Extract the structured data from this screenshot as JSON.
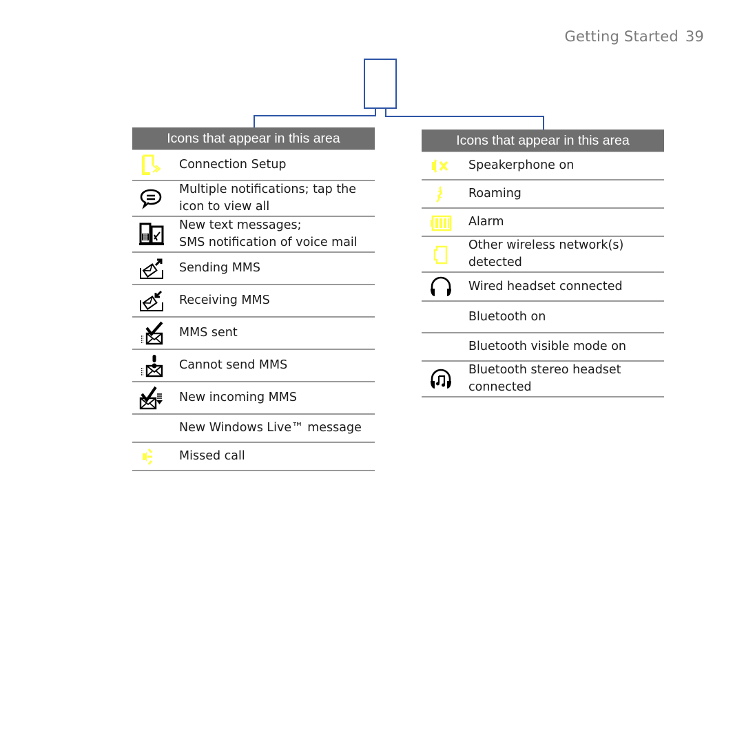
{
  "running_head": {
    "section": "Getting Started",
    "page": "39"
  },
  "diagram": {
    "colors": {
      "line": "#2e55a5",
      "icon_yellow": "#ffff44",
      "header_bg": "#6f6f6f"
    }
  },
  "left_table": {
    "header": "Icons that appear in this area",
    "rows": [
      {
        "icon": "connection-setup-icon",
        "label": "Connection Setup"
      },
      {
        "icon": "speech-bubble-icon",
        "label": "Multiple notifications; tap the icon to view all"
      },
      {
        "icon": "sms-voicemail-icon",
        "label": "New text messages;\nSMS notification of voice mail"
      },
      {
        "icon": "sending-mms-icon",
        "label": "Sending MMS"
      },
      {
        "icon": "receiving-mms-icon",
        "label": "Receiving MMS"
      },
      {
        "icon": "mms-sent-icon",
        "label": "MMS sent"
      },
      {
        "icon": "cannot-send-mms-icon",
        "label": "Cannot send MMS"
      },
      {
        "icon": "new-incoming-mms-icon",
        "label": "New incoming MMS"
      },
      {
        "icon": "",
        "label": "New Windows Live™ message"
      },
      {
        "icon": "missed-call-icon",
        "label": "Missed call"
      }
    ]
  },
  "right_table": {
    "header": "Icons that appear in this area",
    "rows": [
      {
        "icon": "speakerphone-icon",
        "label": "Speakerphone on"
      },
      {
        "icon": "roaming-icon",
        "label": "Roaming"
      },
      {
        "icon": "alarm-icon",
        "label": "Alarm"
      },
      {
        "icon": "wireless-network-icon",
        "label": "Other wireless network(s) detected"
      },
      {
        "icon": "wired-headset-icon",
        "label": "Wired headset connected"
      },
      {
        "icon": "",
        "label": "Bluetooth on"
      },
      {
        "icon": "",
        "label": "Bluetooth visible mode on"
      },
      {
        "icon": "bluetooth-stereo-headset-icon",
        "label": "Bluetooth stereo headset connected"
      }
    ]
  }
}
